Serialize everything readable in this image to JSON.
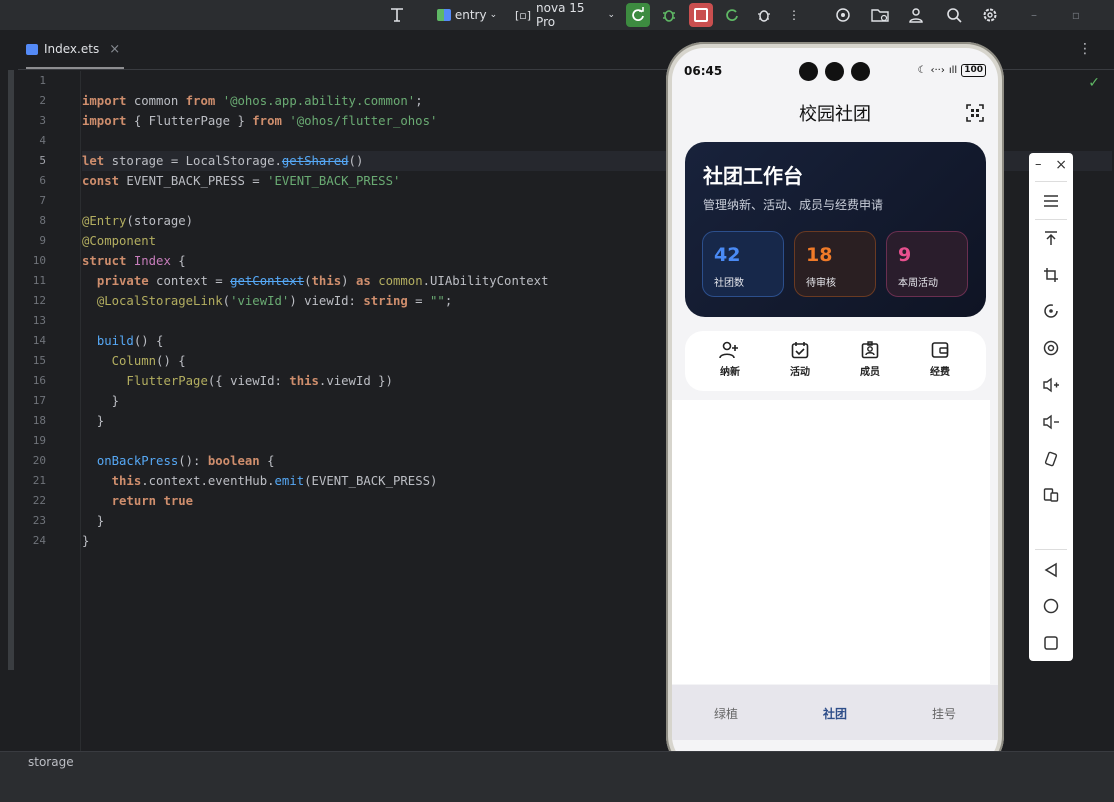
{
  "toolbar": {
    "module": "entry",
    "device": "nova 15 Pro"
  },
  "editor": {
    "tab_name": "Index.ets",
    "tab_close": "×",
    "status_text": "storage",
    "line_numbers": [
      "1",
      "2",
      "3",
      "4",
      "5",
      "6",
      "7",
      "8",
      "9",
      "10",
      "11",
      "12",
      "13",
      "14",
      "15",
      "16",
      "17",
      "18",
      "19",
      "20",
      "21",
      "22",
      "23",
      "24"
    ]
  },
  "phone": {
    "time": "06:45",
    "battery": "100",
    "title": "校园社团",
    "hero": {
      "title": "社团工作台",
      "subtitle": "管理纳新、活动、成员与经费申请",
      "stats": [
        {
          "value": "42",
          "label": "社团数",
          "color": "#4a8af4"
        },
        {
          "value": "18",
          "label": "待审核",
          "color": "#f07a28"
        },
        {
          "value": "9",
          "label": "本周活动",
          "color": "#e8508f"
        }
      ]
    },
    "quick_actions": [
      {
        "label": "纳新",
        "icon": "recruit-icon"
      },
      {
        "label": "活动",
        "icon": "calendar-check-icon"
      },
      {
        "label": "成员",
        "icon": "member-card-icon"
      },
      {
        "label": "经费",
        "icon": "wallet-icon"
      }
    ],
    "nav": [
      {
        "label": "绿植"
      },
      {
        "label": "社团",
        "active": true
      },
      {
        "label": "挂号"
      }
    ]
  },
  "colors": {
    "ide_bg": "#1e1f22",
    "keyword": "#cf8e6d",
    "string": "#6aab73",
    "hero_bg": "#111827",
    "nav_active": "#2f4f8a"
  }
}
